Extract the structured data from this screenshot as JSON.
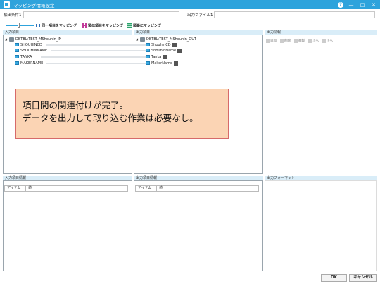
{
  "window": {
    "title": "マッピング情報設定",
    "controls": {
      "help": "?",
      "minimize": "—",
      "restore": "□",
      "close": "✕"
    }
  },
  "filters": {
    "extract_label": "抽出条件1",
    "extract_value": "",
    "output_file_label": "出力ファイル1",
    "output_file_value": ""
  },
  "toolbar": {
    "slider_value": 0.45,
    "same_item_label": "同一項目をマッピング",
    "similar_item_label": "類似項目をマッピング",
    "order_label": "順番にマッピング"
  },
  "input_panel": {
    "header": "入力項目",
    "root": "DBTBL:TEST_MShouhin_IN",
    "fields": [
      "SHOUHINCD",
      "SHOUHINNAME",
      "TANKA",
      "MAKERNAME"
    ]
  },
  "output_panel": {
    "header": "出力項目",
    "root": "DBTBL:TEST_MShouhin_OUT",
    "fields": [
      "ShouhinCD",
      "ShouhinName",
      "Tanka",
      "MakerName"
    ]
  },
  "output_info": {
    "header": "出力情報",
    "tools": [
      "追加",
      "削除",
      "複製",
      "上へ",
      "下へ"
    ]
  },
  "overlay": {
    "line1": "項目間の関連付けが完了。",
    "line2": "データを出力して取り込む作業は必要なし。"
  },
  "input_info": {
    "header": "入力項目情報",
    "columns": [
      "アイテム",
      "値"
    ]
  },
  "output_item_info": {
    "header": "出力項目情報",
    "columns": [
      "アイテム",
      "値"
    ]
  },
  "output_format": {
    "header": "出力フォーマット"
  },
  "buttons": {
    "ok": "OK",
    "cancel": "キャンセル"
  },
  "colors": {
    "accent": "#2ea3dc",
    "overlay_bg": "#fbd4b4",
    "overlay_border": "#d66a6a"
  }
}
